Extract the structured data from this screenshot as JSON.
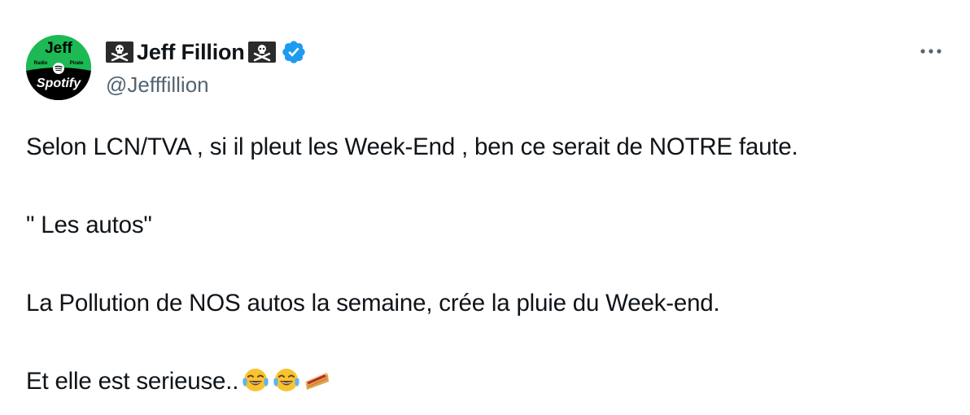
{
  "tweet": {
    "author": {
      "display_name": "Jeff Fillion",
      "handle": "@Jefffillion",
      "verified": true,
      "name_decorations": [
        "pirate-flag-icon",
        "pirate-flag-icon"
      ],
      "avatar": {
        "top_text": "Jeff",
        "middle_left": "Radio",
        "middle_right": "Pirate",
        "bottom_text": "Spotify",
        "top_color": "#1db954",
        "bottom_color": "#000000"
      }
    },
    "more_icon": "more-horizontal-icon",
    "lines": [
      "Selon LCN/TVA , si il pleut les Week-End , ben ce serait de NOTRE faute.",
      "\" Les autos\"",
      "La Pollution de NOS autos la semaine, crée la pluie du Week-end.",
      "Et elle est serieuse.."
    ],
    "trailing_emoji": [
      "tears-of-joy-icon",
      "tears-of-joy-icon",
      "pie-icon"
    ]
  },
  "colors": {
    "text": "#0f1419",
    "secondary": "#536471",
    "verified_blue": "#1d9bf0"
  }
}
